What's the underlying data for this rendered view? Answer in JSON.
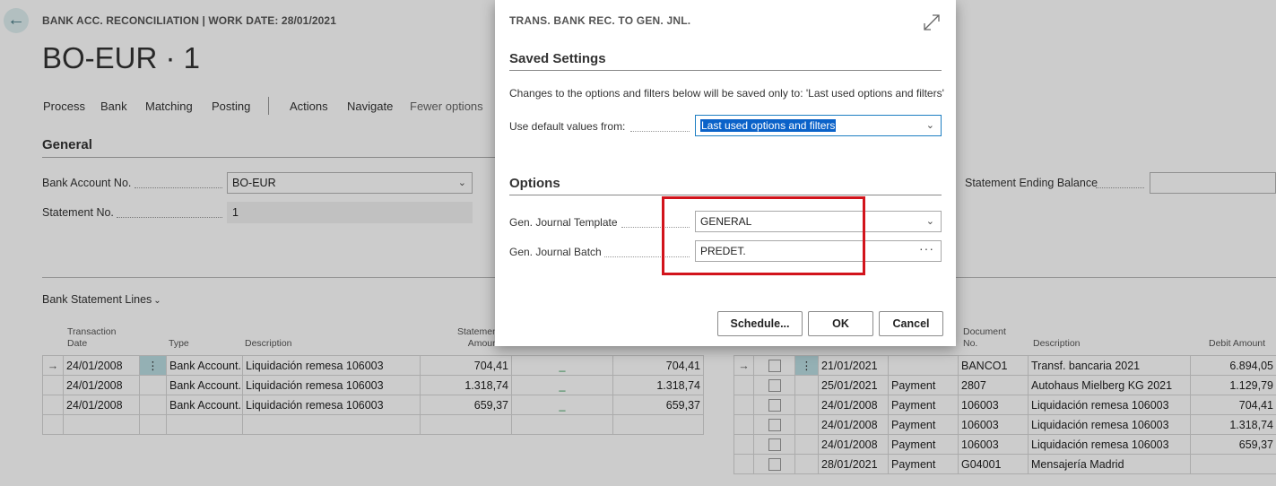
{
  "page": {
    "breadcrumb": "BANK ACC. RECONCILIATION | WORK DATE: 28/01/2021",
    "title": "BO-EUR · 1",
    "menu": [
      "Process",
      "Bank",
      "Matching",
      "Posting",
      "Actions",
      "Navigate",
      "Fewer options"
    ],
    "general": {
      "section_title": "General",
      "bank_account_label": "Bank Account No.",
      "bank_account_value": "BO-EUR",
      "statement_no_label": "Statement No.",
      "statement_no_value": "1",
      "ending_balance_label": "Statement Ending Balance"
    },
    "lines_title": "Bank Statement Lines",
    "left_table": {
      "headers": {
        "date": "Transaction\nDate",
        "type": "Type",
        "description": "Description",
        "amount": "Statement\nAmount"
      },
      "rows": [
        {
          "date": "24/01/2008",
          "type": "Bank Account...",
          "description": "Liquidación remesa 106003",
          "amount": "704,41",
          "mark": "_",
          "applied": "704,41"
        },
        {
          "date": "24/01/2008",
          "type": "Bank Account...",
          "description": "Liquidación remesa 106003",
          "amount": "1.318,74",
          "mark": "_",
          "applied": "1.318,74"
        },
        {
          "date": "24/01/2008",
          "type": "Bank Account...",
          "description": "Liquidación remesa 106003",
          "amount": "659,37",
          "mark": "_",
          "applied": "659,37"
        }
      ]
    },
    "right_table": {
      "headers": {
        "doc_no": "Document\nNo.",
        "description": "Description",
        "debit": "Debit Amount"
      },
      "rows": [
        {
          "date": "21/01/2021",
          "type": "",
          "doc_no": "BANCO1",
          "description": "Transf. bancaria 2021",
          "debit": "6.894,05"
        },
        {
          "date": "25/01/2021",
          "type": "Payment",
          "doc_no": "2807",
          "description": "Autohaus Mielberg KG 2021",
          "debit": "1.129,79"
        },
        {
          "date": "24/01/2008",
          "type": "Payment",
          "doc_no": "106003",
          "description": "Liquidación remesa 106003",
          "debit": "704,41"
        },
        {
          "date": "24/01/2008",
          "type": "Payment",
          "doc_no": "106003",
          "description": "Liquidación remesa 106003",
          "debit": "1.318,74"
        },
        {
          "date": "24/01/2008",
          "type": "Payment",
          "doc_no": "106003",
          "description": "Liquidación remesa 106003",
          "debit": "659,37"
        },
        {
          "date": "28/01/2021",
          "type": "Payment",
          "doc_no": "G04001",
          "description": "Mensajería Madrid",
          "debit": ""
        }
      ]
    }
  },
  "dialog": {
    "caption": "TRANS. BANK REC. TO GEN. JNL.",
    "saved_settings": {
      "title": "Saved Settings",
      "note": "Changes to the options and filters below will be saved only to: 'Last used options and filters'",
      "default_label": "Use default values from:",
      "default_value": "Last used options and filters"
    },
    "options": {
      "title": "Options",
      "template_label": "Gen. Journal Template",
      "template_value": "GENERAL",
      "batch_label": "Gen. Journal Batch",
      "batch_value": "PREDET."
    },
    "buttons": {
      "schedule": "Schedule...",
      "ok": "OK",
      "cancel": "Cancel"
    }
  },
  "colors": {
    "highlight": "#d2141c",
    "selection": "#0a62c9",
    "accent": "#4a7d87"
  }
}
